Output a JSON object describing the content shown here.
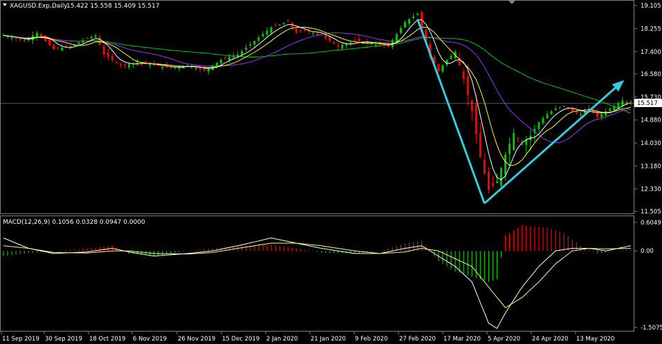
{
  "header": {
    "symbol_text": "XAGUSD.Exp,Daily",
    "ohlc_text": "15.422 15.558 15.409 15.517",
    "triangle_icon": "triangle-down-icon"
  },
  "macd_header": {
    "text": "MACD(12,26,9) 0.1056 0.0328 0.0947 0.0000"
  },
  "current_price_label": "15.517",
  "colors": {
    "background": "#000000",
    "bull_candle": "#00c800",
    "bear_candle": "#ff0000",
    "ma_fast": "#ffffff",
    "ma_mid": "#ffff00",
    "ma_slow": "#9b30ff",
    "ma_long": "#00c800",
    "arrow": "#33ccdd",
    "macd_signal": "#ffff66"
  },
  "chart_data": {
    "type": "candlestick",
    "price_axis_ticks": [
      "19.105",
      "18.255",
      "17.400",
      "16.580",
      "15.730",
      "14.880",
      "14.030",
      "13.180",
      "12.330",
      "11.505"
    ],
    "macd_axis_ticks": [
      "0.6049",
      "0.00",
      "-1.5075"
    ],
    "date_ticks": [
      "11 Sep 2019",
      "30 Sep 2019",
      "18 Oct 2019",
      "6 Nov 2019",
      "26 Nov 2019",
      "15 Dec 2019",
      "2 Jan 2020",
      "21 Jan 2020",
      "9 Feb 2020",
      "27 Feb 2020",
      "17 Mar 2020",
      "5 Apr 2020",
      "24 Apr 2020",
      "13 May 2020"
    ],
    "price_ylim": [
      11.505,
      19.105
    ],
    "macd_ylim": [
      -1.5075,
      0.6049
    ],
    "last_price": 15.517,
    "close_path": [
      [
        0,
        18.0
      ],
      [
        5,
        17.8
      ],
      [
        8,
        18.1
      ],
      [
        12,
        17.5
      ],
      [
        16,
        17.6
      ],
      [
        20,
        17.9
      ],
      [
        22,
        18.0
      ],
      [
        24,
        17.3
      ],
      [
        28,
        16.9
      ],
      [
        32,
        17.0
      ],
      [
        36,
        16.9
      ],
      [
        40,
        16.8
      ],
      [
        44,
        16.9
      ],
      [
        48,
        16.7
      ],
      [
        52,
        17.1
      ],
      [
        56,
        17.3
      ],
      [
        60,
        17.8
      ],
      [
        64,
        18.3
      ],
      [
        68,
        18.5
      ],
      [
        70,
        18.1
      ],
      [
        72,
        18.2
      ],
      [
        76,
        18.0
      ],
      [
        80,
        17.6
      ],
      [
        84,
        17.8
      ],
      [
        88,
        17.7
      ],
      [
        92,
        17.6
      ],
      [
        96,
        18.5
      ],
      [
        99,
        18.8
      ],
      [
        102,
        17.2
      ],
      [
        104,
        16.7
      ],
      [
        106,
        17.1
      ],
      [
        108,
        17.4
      ],
      [
        110,
        16.4
      ],
      [
        112,
        15.2
      ],
      [
        114,
        13.5
      ],
      [
        116,
        12.3
      ],
      [
        118,
        12.6
      ],
      [
        120,
        13.6
      ],
      [
        122,
        14.4
      ],
      [
        124,
        14.0
      ],
      [
        126,
        14.3
      ],
      [
        128,
        14.8
      ],
      [
        130,
        15.1
      ],
      [
        132,
        15.3
      ],
      [
        134,
        15.4
      ],
      [
        136,
        15.2
      ],
      [
        138,
        15.1
      ],
      [
        140,
        15.3
      ],
      [
        142,
        15.0
      ],
      [
        144,
        15.2
      ],
      [
        146,
        15.4
      ],
      [
        148,
        15.6
      ],
      [
        150,
        15.517
      ]
    ],
    "macd_hist_path": [
      [
        0,
        -0.1
      ],
      [
        5,
        -0.05
      ],
      [
        12,
        0.0
      ],
      [
        20,
        0.05
      ],
      [
        26,
        0.1
      ],
      [
        30,
        -0.05
      ],
      [
        36,
        -0.1
      ],
      [
        44,
        0.0
      ],
      [
        50,
        0.05
      ],
      [
        56,
        0.1
      ],
      [
        64,
        0.12
      ],
      [
        70,
        0.05
      ],
      [
        76,
        -0.03
      ],
      [
        84,
        -0.05
      ],
      [
        90,
        0.0
      ],
      [
        96,
        0.15
      ],
      [
        100,
        0.2
      ],
      [
        104,
        -0.2
      ],
      [
        108,
        -0.4
      ],
      [
        112,
        -0.5
      ],
      [
        116,
        -0.6
      ],
      [
        118,
        -0.55
      ],
      [
        120,
        0.3
      ],
      [
        124,
        0.5
      ],
      [
        130,
        0.45
      ],
      [
        134,
        0.35
      ],
      [
        138,
        0.1
      ],
      [
        142,
        -0.05
      ],
      [
        146,
        0.0
      ],
      [
        150,
        0.03
      ]
    ],
    "macd_line_path": [
      [
        0,
        0.25
      ],
      [
        6,
        0.05
      ],
      [
        12,
        -0.05
      ],
      [
        20,
        -0.02
      ],
      [
        26,
        0.05
      ],
      [
        30,
        -0.02
      ],
      [
        36,
        -0.1
      ],
      [
        44,
        -0.05
      ],
      [
        50,
        0.0
      ],
      [
        56,
        0.1
      ],
      [
        64,
        0.25
      ],
      [
        70,
        0.15
      ],
      [
        76,
        0.05
      ],
      [
        84,
        -0.05
      ],
      [
        90,
        -0.05
      ],
      [
        96,
        0.05
      ],
      [
        100,
        0.1
      ],
      [
        104,
        -0.1
      ],
      [
        108,
        -0.3
      ],
      [
        112,
        -0.6
      ],
      [
        116,
        -1.4
      ],
      [
        118,
        -1.5
      ],
      [
        120,
        -1.2
      ],
      [
        124,
        -0.7
      ],
      [
        128,
        -0.3
      ],
      [
        132,
        0.0
      ],
      [
        136,
        0.05
      ],
      [
        140,
        0.05
      ],
      [
        144,
        0.0
      ],
      [
        150,
        0.1
      ]
    ],
    "macd_signal_path": [
      [
        0,
        0.1
      ],
      [
        6,
        0.05
      ],
      [
        12,
        -0.03
      ],
      [
        20,
        -0.04
      ],
      [
        26,
        0.0
      ],
      [
        30,
        0.0
      ],
      [
        36,
        -0.05
      ],
      [
        44,
        -0.06
      ],
      [
        50,
        -0.03
      ],
      [
        56,
        0.05
      ],
      [
        64,
        0.15
      ],
      [
        70,
        0.15
      ],
      [
        76,
        0.1
      ],
      [
        84,
        0.0
      ],
      [
        90,
        -0.05
      ],
      [
        96,
        -0.02
      ],
      [
        100,
        0.05
      ],
      [
        104,
        0.0
      ],
      [
        108,
        -0.15
      ],
      [
        112,
        -0.3
      ],
      [
        116,
        -0.7
      ],
      [
        118,
        -0.9
      ],
      [
        120,
        -1.1
      ],
      [
        124,
        -0.9
      ],
      [
        128,
        -0.6
      ],
      [
        132,
        -0.25
      ],
      [
        136,
        0.0
      ],
      [
        140,
        0.05
      ],
      [
        144,
        0.04
      ],
      [
        150,
        0.05
      ]
    ],
    "annotation_arrows": [
      {
        "from": [
          99,
          18.6
        ],
        "to": [
          115,
          11.8
        ]
      },
      {
        "from": [
          115,
          11.8
        ],
        "to": [
          148,
          16.3
        ]
      }
    ]
  }
}
